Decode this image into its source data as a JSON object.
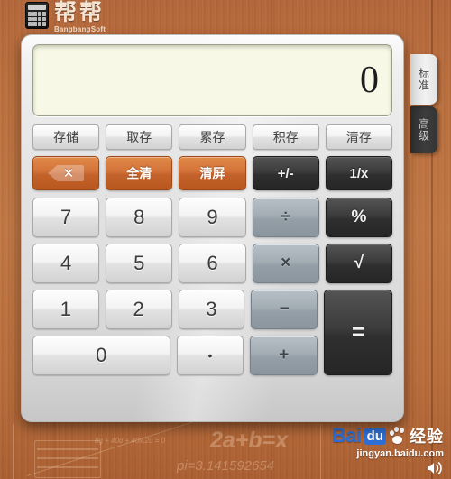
{
  "brand": {
    "logo_icon": "calculator-icon",
    "name_cn": "帮帮",
    "name_en": "BangbangSoft"
  },
  "tabs": [
    {
      "id": "standard",
      "label": "标准",
      "active": true
    },
    {
      "id": "advanced",
      "label": "高级",
      "active": false
    }
  ],
  "display": {
    "value": "0",
    "background_color": "#f7f8e6"
  },
  "colors": {
    "wood": "#bb6f3d",
    "panel": "#e6e6e6",
    "orange_key": "#d4743a",
    "dark_key": "#3c3c3c",
    "slate_key": "#a3adb4",
    "light_key": "#f3f3f3",
    "baidu_blue": "#2e6fd4"
  },
  "memory_row": [
    {
      "label": "存储",
      "name": "memory-store-button"
    },
    {
      "label": "取存",
      "name": "memory-recall-button"
    },
    {
      "label": "累存",
      "name": "memory-add-button"
    },
    {
      "label": "积存",
      "name": "memory-multiply-button"
    },
    {
      "label": "清存",
      "name": "memory-clear-button"
    }
  ],
  "function_row": {
    "backspace": {
      "icon": "backspace-icon",
      "glyph": "✕"
    },
    "clear_all": "全清",
    "clear_screen": "清屏",
    "sign": "+/-",
    "reciprocal": "1/x"
  },
  "keypad": {
    "row1": {
      "d7": "7",
      "d8": "8",
      "d9": "9",
      "divide": "÷",
      "percent": "%"
    },
    "row2": {
      "d4": "4",
      "d5": "5",
      "d6": "6",
      "multiply": "×",
      "sqrt": "√"
    },
    "row3": {
      "d1": "1",
      "d2": "2",
      "d3": "3",
      "minus": "−"
    },
    "row4": {
      "d0": "0",
      "dot": "•",
      "plus": "+"
    },
    "equals": "="
  },
  "watermark": {
    "baidu_word": "Bai",
    "baidu_du": "du",
    "jingyan": "经验",
    "url": "jingyan.baidu.com",
    "speaker_icon": "speaker-icon",
    "chalk_formula_1": "2a+b=x",
    "chalk_formula_2": "pi=3.141592654",
    "chalk_formula_3": "8g + 40d + 40x,2u = 0",
    "abacus_icon": "abacus-icon"
  }
}
